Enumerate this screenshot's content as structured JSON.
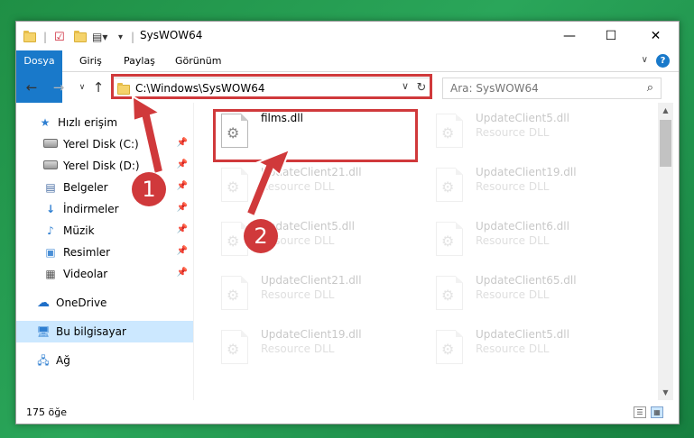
{
  "window": {
    "title": "SysWOW64"
  },
  "ribbon": {
    "tabs": [
      "Dosya",
      "Giriş",
      "Paylaş",
      "Görünüm"
    ]
  },
  "address": {
    "path": "C:\\Windows\\SysWOW64"
  },
  "search": {
    "placeholder": "Ara: SysWOW64"
  },
  "sidebar": {
    "items": [
      {
        "label": "Hızlı erişim",
        "icon": "star-icon",
        "pinned": false
      },
      {
        "label": "Yerel Disk (C:)",
        "icon": "drive-icon",
        "pinned": true
      },
      {
        "label": "Yerel Disk (D:)",
        "icon": "drive-icon",
        "pinned": true
      },
      {
        "label": "Belgeler",
        "icon": "document-icon",
        "pinned": true
      },
      {
        "label": "İndirmeler",
        "icon": "download-icon",
        "pinned": true
      },
      {
        "label": "Müzik",
        "icon": "music-icon",
        "pinned": true
      },
      {
        "label": "Resimler",
        "icon": "pictures-icon",
        "pinned": true
      },
      {
        "label": "Videolar",
        "icon": "video-icon",
        "pinned": true
      },
      {
        "label": "OneDrive",
        "icon": "cloud-icon",
        "pinned": false
      },
      {
        "label": "Bu bilgisayar",
        "icon": "computer-icon",
        "pinned": false
      },
      {
        "label": "Ağ",
        "icon": "network-icon",
        "pinned": false
      }
    ]
  },
  "files": [
    {
      "name": "films.dll",
      "type": ""
    },
    {
      "name": "UpdateClient5.dll",
      "type": "Resource DLL"
    },
    {
      "name": "UpdateClient21.dll",
      "type": "Resource DLL"
    },
    {
      "name": "UpdateClient19.dll",
      "type": "Resource DLL"
    },
    {
      "name": "UpdateClient5.dll",
      "type": "Resource DLL"
    },
    {
      "name": "UpdateClient6.dll",
      "type": "Resource DLL"
    },
    {
      "name": "UpdateClient21.dll",
      "type": "Resource DLL"
    },
    {
      "name": "UpdateClient65.dll",
      "type": "Resource DLL"
    },
    {
      "name": "UpdateClient19.dll",
      "type": "Resource DLL"
    },
    {
      "name": "UpdateClient5.dll",
      "type": "Resource DLL"
    }
  ],
  "status": {
    "count": "175 öğe"
  },
  "annotations": {
    "badge1": "1",
    "badge2": "2"
  },
  "colors": {
    "accent": "#1979ca",
    "callout": "#d0393b",
    "selected": "#cce8ff"
  }
}
